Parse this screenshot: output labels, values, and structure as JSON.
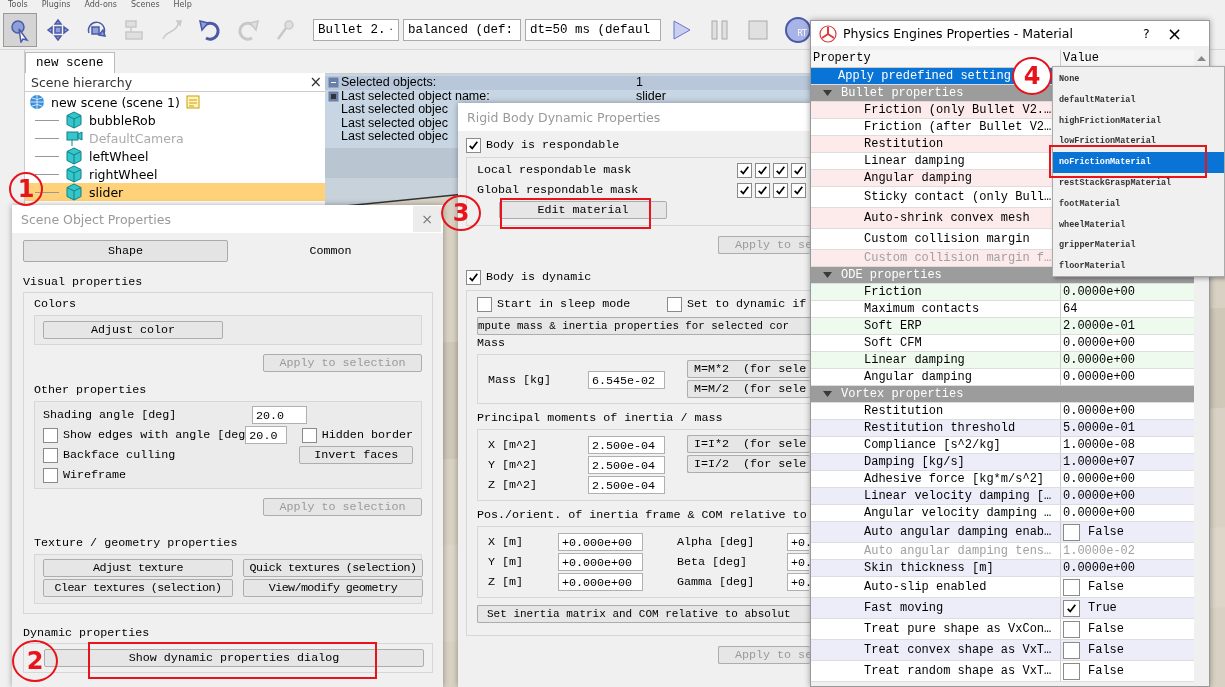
{
  "menu": [
    "Tools",
    "Plugins",
    "Add-ons",
    "Scenes",
    "Help"
  ],
  "toolbar": {
    "tools": [
      {
        "kind": "pointer",
        "selected": true,
        "disabled": false
      },
      {
        "kind": "move",
        "selected": false,
        "disabled": false
      },
      {
        "kind": "rotate",
        "selected": false,
        "disabled": false
      },
      {
        "kind": "assemble",
        "selected": false,
        "disabled": true
      },
      {
        "kind": "path",
        "selected": false,
        "disabled": true
      },
      {
        "kind": "undo",
        "selected": false,
        "disabled": false
      },
      {
        "kind": "redo",
        "selected": false,
        "disabled": true
      },
      {
        "kind": "pin",
        "selected": false,
        "disabled": true
      }
    ],
    "dropdowns": [
      "Bullet 2.",
      "balanced (def:",
      "dt=50 ms (defaul"
    ],
    "sim": [
      {
        "kind": "play"
      },
      {
        "kind": "pause"
      },
      {
        "kind": "stop"
      },
      {
        "kind": "realtime",
        "label": "RT"
      }
    ]
  },
  "scene_tab": "new scene",
  "hierarchy": {
    "title": "Scene hierarchy",
    "close": "×",
    "root": {
      "label": "new scene (scene 1)",
      "children": [
        {
          "label": "bubbleRob",
          "kind": "shape",
          "disabled": false,
          "selected": false
        },
        {
          "label": "DefaultCamera",
          "kind": "camera",
          "disabled": true,
          "selected": false
        },
        {
          "label": "leftWheel",
          "kind": "shape",
          "disabled": false,
          "selected": false
        },
        {
          "label": "rightWheel",
          "kind": "shape",
          "disabled": false,
          "selected": false
        },
        {
          "label": "slider",
          "kind": "shape",
          "disabled": false,
          "selected": true
        }
      ]
    }
  },
  "info": [
    {
      "label": "Selected objects:",
      "value": "1",
      "kind": "collapse"
    },
    {
      "label": "Last selected object name:",
      "value": "slider",
      "kind": "expand"
    },
    {
      "label": "Last selected objec",
      "kind": "plain"
    },
    {
      "label": "Last selected objec",
      "kind": "plain"
    },
    {
      "label": "Last selected objec",
      "kind": "plain"
    }
  ],
  "scene_object_properties": {
    "title": "Scene Object Properties",
    "close": "×",
    "tabs": [
      {
        "label": "Shape",
        "selected": true
      },
      {
        "label": "Common",
        "selected": false
      }
    ],
    "visual": {
      "title": "Visual properties",
      "colors_title": "Colors",
      "adjust_color": "Adjust color",
      "apply": {
        "label": "Apply to selection",
        "disabled": true
      }
    },
    "other": {
      "title": "Other properties",
      "shading_label": "Shading angle [deg]",
      "shading_value": "20.0",
      "show_edges": {
        "label": "Show edges with angle [deg",
        "checked": false
      },
      "edges_value": "20.0",
      "hidden_border": {
        "label": "Hidden border",
        "checked": false
      },
      "backface": {
        "label": "Backface culling",
        "checked": false
      },
      "invert": "Invert faces",
      "wireframe": {
        "label": "Wireframe",
        "checked": false
      },
      "apply": {
        "label": "Apply to selection",
        "disabled": true
      }
    },
    "texture": {
      "title": "Texture / geometry properties",
      "buttons": [
        "Adjust texture",
        "Quick textures (selection)",
        "Clear textures (selection)",
        "View/modify geometry"
      ]
    },
    "dynamic": {
      "title": "Dynamic properties",
      "button": "Show dynamic properties dialog"
    }
  },
  "rigid_body": {
    "title": "Rigid Body Dynamic Properties",
    "respondable": {
      "label": "Body is respondable",
      "checked": true
    },
    "local_mask": {
      "label": "Local respondable mask",
      "bits": [
        true,
        true,
        true,
        true
      ]
    },
    "global_mask": {
      "label": "Global respondable mask",
      "bits": [
        true,
        true,
        true,
        true
      ]
    },
    "edit_material": "Edit material",
    "apply_top": {
      "label": "Apply to se",
      "disabled": true
    },
    "dynamic": {
      "label": "Body is dynamic",
      "checked": true
    },
    "sleep": {
      "label": "Start in sleep mode",
      "checked": false
    },
    "set_dynamic": {
      "label": "Set to dynamic if",
      "checked": false
    },
    "compute": "mpute mass & inertia properties for selected cor",
    "mass_title": "Mass",
    "mass_label": "Mass [kg]",
    "mass_value": "6.545e-02",
    "mass_buttons": [
      "M=M*2  (for sele",
      "M=M/2  (for sele"
    ],
    "inertia_title": "Principal moments of inertia / mass",
    "inertia": [
      {
        "label": "X [m^2]",
        "value": "2.500e-04"
      },
      {
        "label": "Y [m^2]",
        "value": "2.500e-04"
      },
      {
        "label": "Z [m^2]",
        "value": "2.500e-04"
      }
    ],
    "inertia_buttons": [
      "I=I*2  (for sele",
      "I=I/2  (for sele"
    ],
    "frame_title": "Pos./orient. of inertia frame & COM relative to",
    "position": [
      {
        "label": "X [m]",
        "value": "+0.000e+00",
        "angle_label": "Alpha [deg]",
        "angle_value": "+0."
      },
      {
        "label": "Y [m]",
        "value": "+0.000e+00",
        "angle_label": "Beta [deg]",
        "angle_value": "+0."
      },
      {
        "label": "Z [m]",
        "value": "+0.000e+00",
        "angle_label": "Gamma [deg]",
        "angle_value": "+0."
      }
    ],
    "set_inertia": "Set inertia matrix and COM relative to absolut",
    "apply_bottom": {
      "label": "Apply to se",
      "disabled": true
    }
  },
  "physics": {
    "title": "Physics Engines Properties - Material",
    "help": "?",
    "close": "×",
    "columns": [
      "Property",
      "Value"
    ],
    "apply_row": {
      "label": "Apply predefined setting",
      "selected": true
    },
    "sections": [
      {
        "title": "Bullet properties",
        "expanded": true,
        "color": "#fdeaea",
        "first_shaded": true,
        "rows": [
          {
            "label": "Friction (only Bullet V2.…",
            "kind": "number",
            "disabled": false
          },
          {
            "label": "Friction (after Bullet V2…",
            "kind": "number",
            "disabled": false
          },
          {
            "label": "Restitution",
            "kind": "number",
            "disabled": false
          },
          {
            "label": "Linear damping",
            "kind": "number",
            "disabled": false
          },
          {
            "label": "Angular damping",
            "kind": "number",
            "disabled": false
          },
          {
            "label": "Sticky contact (only Bull…",
            "kind": "bool",
            "disabled": false
          },
          {
            "label": "Auto-shrink convex mesh",
            "kind": "bool",
            "disabled": false
          },
          {
            "label": "Custom collision margin",
            "kind": "bool",
            "disabled": false
          },
          {
            "label": "Custom collision margin f…",
            "kind": "number",
            "disabled": true
          }
        ]
      },
      {
        "title": "ODE properties",
        "expanded": true,
        "color": "#edfaed",
        "first_shaded": true,
        "rows": [
          {
            "label": "Friction",
            "kind": "number",
            "disabled": false,
            "value": "0.0000e+00"
          },
          {
            "label": "Maximum contacts",
            "kind": "number",
            "disabled": false,
            "value": "64"
          },
          {
            "label": "Soft ERP",
            "kind": "number",
            "disabled": false,
            "value": "2.0000e-01"
          },
          {
            "label": "Soft CFM",
            "kind": "number",
            "disabled": false,
            "value": "0.0000e+00"
          },
          {
            "label": "Linear damping",
            "kind": "number",
            "disabled": false,
            "value": "0.0000e+00"
          },
          {
            "label": "Angular damping",
            "kind": "number",
            "disabled": false,
            "value": "0.0000e+00"
          }
        ]
      },
      {
        "title": "Vortex properties",
        "expanded": true,
        "color": "#ededfa",
        "first_shaded": false,
        "rows": [
          {
            "label": "Restitution",
            "kind": "number",
            "disabled": false,
            "value": "0.0000e+00"
          },
          {
            "label": "Restitution threshold",
            "kind": "number",
            "disabled": false,
            "value": "5.0000e-01"
          },
          {
            "label": "Compliance [s^2/kg]",
            "kind": "number",
            "disabled": false,
            "value": "1.0000e-08"
          },
          {
            "label": "Damping [kg/s]",
            "kind": "number",
            "disabled": false,
            "value": "1.0000e+07"
          },
          {
            "label": "Adhesive force [kg*m/s^2]",
            "kind": "number",
            "disabled": false,
            "value": "0.0000e+00"
          },
          {
            "label": "Linear velocity damping […",
            "kind": "number",
            "disabled": false,
            "value": "0.0000e+00"
          },
          {
            "label": "Angular velocity damping …",
            "kind": "number",
            "disabled": false,
            "value": "0.0000e+00"
          },
          {
            "label": "Auto angular damping enab…",
            "kind": "bool",
            "disabled": false,
            "checked": false,
            "value": "False"
          },
          {
            "label": "Auto angular damping tens…",
            "kind": "number",
            "disabled": true,
            "value": "1.0000e-02"
          },
          {
            "label": "Skin thickness [m]",
            "kind": "number",
            "disabled": false,
            "value": "0.0000e+00"
          },
          {
            "label": "Auto-slip enabled",
            "kind": "bool",
            "disabled": false,
            "checked": false,
            "value": "False"
          },
          {
            "label": "Fast moving",
            "kind": "bool",
            "disabled": false,
            "checked": true,
            "value": "True"
          },
          {
            "label": "Treat pure shape as VxCon…",
            "kind": "bool",
            "disabled": false,
            "checked": false,
            "value": "False"
          },
          {
            "label": "Treat convex shape as VxT…",
            "kind": "bool",
            "disabled": false,
            "checked": false,
            "value": "False"
          },
          {
            "label": "Treat random shape as VxT…",
            "kind": "bool",
            "disabled": false,
            "checked": false,
            "value": "False"
          }
        ]
      }
    ]
  },
  "dropdown": [
    {
      "label": "None",
      "selected": false
    },
    {
      "label": "defaultMaterial",
      "selected": false
    },
    {
      "label": "highFrictionMaterial",
      "selected": false
    },
    {
      "label": "lowFrictionMaterial",
      "selected": false
    },
    {
      "label": "noFrictionMaterial",
      "selected": true
    },
    {
      "label": "restStackGraspMaterial",
      "selected": false
    },
    {
      "label": "footMaterial",
      "selected": false
    },
    {
      "label": "wheelMaterial",
      "selected": false
    },
    {
      "label": "gripperMaterial",
      "selected": false
    },
    {
      "label": "floorMaterial",
      "selected": false
    }
  ],
  "annotations": [
    "1",
    "2",
    "3",
    "4"
  ]
}
